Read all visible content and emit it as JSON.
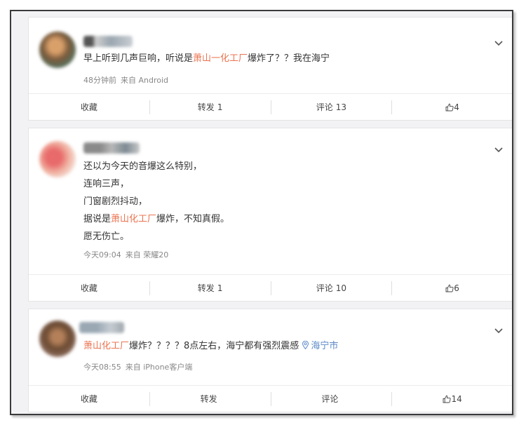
{
  "posts": [
    {
      "content": [
        [
          {
            "t": "早上听到几声巨响，听说是"
          },
          {
            "t": "萧山一化工厂",
            "c": "hl"
          },
          {
            "t": "爆炸了？？我在海宁"
          }
        ]
      ],
      "time": "48分钟前",
      "source": "来自 Android",
      "actions": {
        "favorite": "收藏",
        "repost_label": "转发",
        "repost_count": "1",
        "comment_label": "评论",
        "comment_count": "13",
        "like_count": "4"
      }
    },
    {
      "content": [
        [
          {
            "t": "还以为今天的音爆这么特别，"
          }
        ],
        [
          {
            "t": "连响三声，"
          }
        ],
        [
          {
            "t": "门窗剧烈抖动，"
          }
        ],
        [
          {
            "t": "据说是"
          },
          {
            "t": "萧山化工厂",
            "c": "hl"
          },
          {
            "t": "爆炸，不知真假。"
          }
        ],
        [
          {
            "t": "愿无伤亡。"
          }
        ]
      ],
      "time": "今天09:04",
      "source": "来自 荣耀20",
      "actions": {
        "favorite": "收藏",
        "repost_label": "转发",
        "repost_count": "1",
        "comment_label": "评论",
        "comment_count": "10",
        "like_count": "6"
      }
    },
    {
      "content": [
        [
          {
            "t": "萧山化工厂",
            "c": "hl"
          },
          {
            "t": "爆炸？？？？8点左右，海宁都有强烈震感 "
          },
          {
            "t": "海宁市",
            "c": "loc",
            "icon": "location-pin-icon"
          }
        ]
      ],
      "time": "今天08:55",
      "source": "来自 iPhone客户端",
      "actions": {
        "favorite": "收藏",
        "repost_label": "转发",
        "repost_count": "",
        "comment_label": "评论",
        "comment_count": "",
        "like_count": "14"
      }
    }
  ],
  "colors": {
    "highlight": "#eb7350",
    "location": "#5d89c7",
    "meta": "#888888"
  },
  "icons": {
    "menu": "chevron-down-icon",
    "like": "thumbs-up-icon",
    "location": "location-pin-icon"
  }
}
